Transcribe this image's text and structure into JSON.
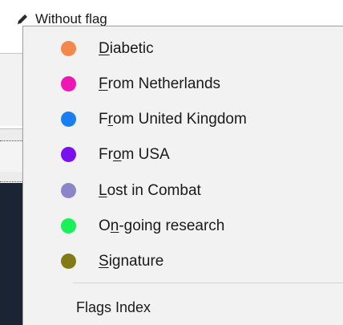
{
  "toolbar": {
    "flag_button_label": "Without flag",
    "flag_button_icon": "pencil-icon"
  },
  "menu": {
    "items": [
      {
        "label_underlined": "D",
        "label_rest": "iabetic",
        "color": "#f4874b"
      },
      {
        "label_underlined": "F",
        "label_rest": "rom Netherlands",
        "color": "#f016b4"
      },
      {
        "label_pre": "F",
        "label_underlined": "r",
        "label_rest": "om United Kingdom",
        "color": "#1a7ef0"
      },
      {
        "label_pre": "Fr",
        "label_underlined": "o",
        "label_rest": "m USA",
        "color": "#7a10f0"
      },
      {
        "label_underlined": "L",
        "label_rest": "ost in Combat",
        "color": "#8a86c8"
      },
      {
        "label_pre": "O",
        "label_underlined": "n",
        "label_rest": "-going research",
        "color": "#1af05a"
      },
      {
        "label_underlined": "S",
        "label_rest": "ignature",
        "color": "#827a16"
      }
    ],
    "index_label": "Flags Index"
  }
}
